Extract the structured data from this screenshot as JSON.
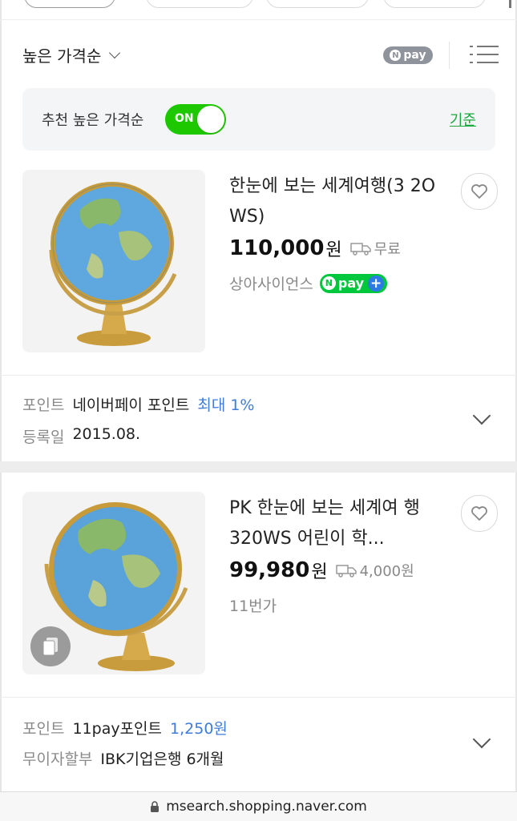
{
  "sort": {
    "label": "높은 가격순",
    "npay_label": "pay",
    "npay_mark": "N"
  },
  "recommend": {
    "label": "추천 높은 가격순",
    "toggle_text": "ON",
    "link": "기준"
  },
  "products": [
    {
      "title": "한눈에 보는 세계여행(3 2O WS)",
      "price": "110,000",
      "currency": "원",
      "shipping": "무료",
      "seller": "상아사이언스",
      "badge": {
        "mark": "N",
        "text": "pay",
        "plus": "+"
      },
      "info": [
        {
          "key": "포인트",
          "value": "네이버페이 포인트",
          "highlight": "최대 1%"
        },
        {
          "key": "등록일",
          "value": "2015.08.",
          "highlight": ""
        }
      ]
    },
    {
      "title": "PK 한눈에 보는 세계여 행 320WS 어린이 학...",
      "price": "99,980",
      "currency": "원",
      "shipping": "4,000원",
      "seller": "11번가",
      "info": [
        {
          "key": "포인트",
          "value": "11pay포인트",
          "highlight": "1,250원"
        },
        {
          "key": "무이자할부",
          "value": "IBK기업은행 6개월",
          "highlight": ""
        }
      ]
    }
  ],
  "url_bar": {
    "url": "msearch.shopping.naver.com"
  },
  "colors": {
    "npay_green": "#00c73c",
    "toggle_green": "#1ec800",
    "link_green": "#1aa83c",
    "highlight_blue": "#3f7bd8"
  }
}
